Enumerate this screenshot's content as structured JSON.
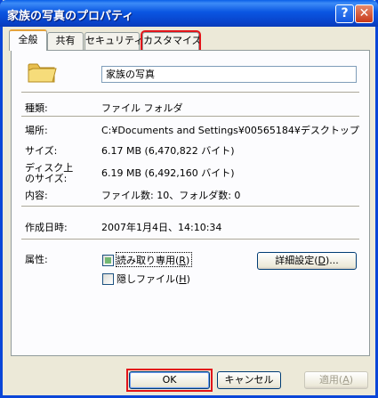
{
  "window": {
    "title": "家族の写真のプロパティ",
    "help_glyph": "?",
    "close_glyph": "✕"
  },
  "tabs": [
    {
      "label": "全般"
    },
    {
      "label": "共有"
    },
    {
      "label": "セキュリティ"
    },
    {
      "label": "カスタマイズ"
    }
  ],
  "general": {
    "folder_name": "家族の写真",
    "rows": {
      "type_label": "種類:",
      "type_value": "ファイル フォルダ",
      "location_label": "場所:",
      "location_value": "C:¥Documents and Settings¥00565184¥デスクトップ",
      "size_label": "サイズ:",
      "size_value": "6.17 MB (6,470,822 バイト)",
      "disk_size_label_1": "ディスク上",
      "disk_size_label_2": "のサイズ:",
      "disk_size_value": "6.19 MB (6,492,160 バイト)",
      "contents_label": "内容:",
      "contents_value": "ファイル数: 10、フォルダ数: 0",
      "created_label": "作成日時:",
      "created_value": "2007年1月4日、14:10:34",
      "attributes_label": "属性:"
    },
    "readonly_label": "読み取り専用(",
    "readonly_key": "R",
    "readonly_close": ")",
    "hidden_label": "隠しファイル(",
    "hidden_key": "H",
    "hidden_close": ")",
    "advanced_label": "詳細設定(",
    "advanced_key": "D",
    "advanced_close": ")..."
  },
  "buttons": {
    "ok": "OK",
    "cancel": "キャンセル",
    "apply_label": "適用(",
    "apply_key": "A",
    "apply_close": ")"
  },
  "colors": {
    "title_bar": "#0a56e2",
    "highlight_outline": "#e2141a",
    "folder_icon": "#f3d46a"
  }
}
